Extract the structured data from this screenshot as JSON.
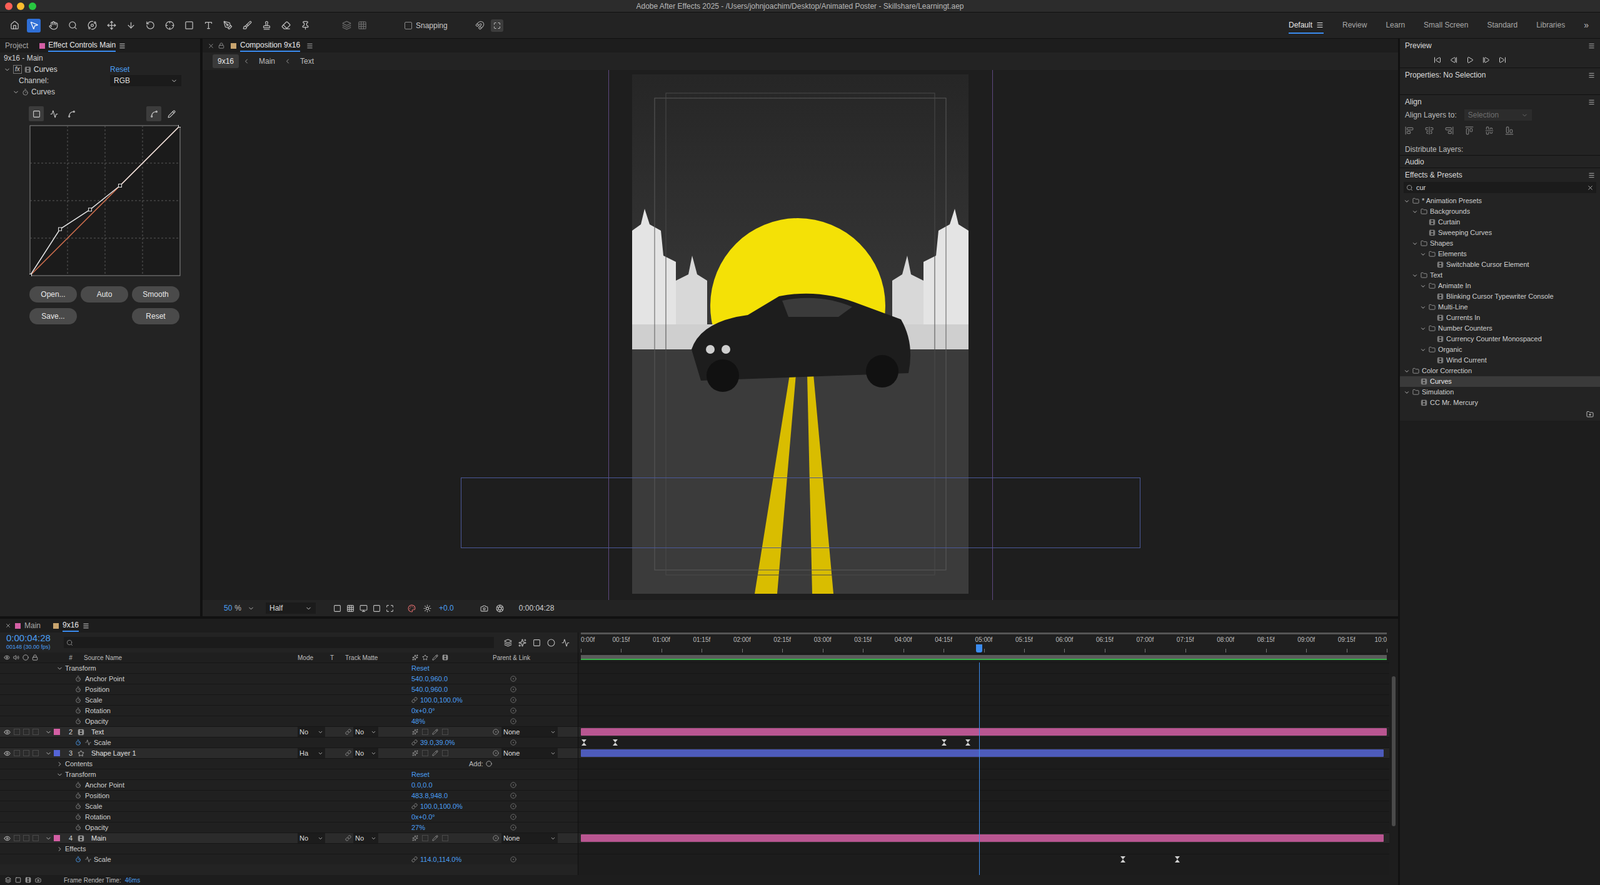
{
  "window": {
    "title": "Adobe After Effects 2025 - /Users/johnjoachim/Desktop/Animated Poster - Skillshare/Learningt.aep"
  },
  "toolbar": {
    "tools": [
      {
        "selected": false
      },
      {
        "selected": true
      },
      {
        "selected": false
      },
      {
        "selected": false
      },
      {
        "selected": false
      },
      {
        "selected": false
      },
      {
        "selected": false
      },
      {
        "selected": false
      },
      {
        "selected": false
      },
      {
        "selected": false
      },
      {
        "selected": false
      },
      {
        "selected": false
      },
      {
        "selected": false
      },
      {
        "selected": false
      },
      {
        "selected": false
      },
      {
        "selected": false
      }
    ],
    "snapping": {
      "label": "Snapping",
      "checked": false
    },
    "workspaces": [
      {
        "label": "Default",
        "selected": true
      },
      {
        "label": "Review",
        "selected": false
      },
      {
        "label": "Learn",
        "selected": false
      },
      {
        "label": "Small Screen",
        "selected": false
      },
      {
        "label": "Standard",
        "selected": false
      },
      {
        "label": "Libraries",
        "selected": false
      }
    ],
    "overflow": "»"
  },
  "effect_controls": {
    "tabs": [
      {
        "label": "Project",
        "selected": false,
        "color": ""
      },
      {
        "label": "Effect Controls Main",
        "selected": true,
        "color": "#d35fa4"
      }
    ],
    "layer": "9x16 - Main",
    "effect": {
      "badge": "fx",
      "name": "Curves",
      "reset": "Reset",
      "expanded": true
    },
    "channel": {
      "label": "Channel:",
      "value": "RGB"
    },
    "curves": {
      "label": "Curves",
      "expanded": true,
      "graph_modes": [
        {
          "selected": true
        },
        {
          "selected": false
        },
        {
          "selected": false
        }
      ],
      "draw_modes": [
        {
          "selected": true
        },
        {
          "selected": false
        }
      ],
      "points": [
        [
          0,
          0
        ],
        [
          0.2,
          0.31
        ],
        [
          0.4,
          0.44
        ],
        [
          0.6,
          0.6
        ],
        [
          1,
          1
        ]
      ]
    },
    "buttons_row1": [
      "Open...",
      "Auto",
      "Smooth"
    ],
    "buttons_row2": [
      "Save...",
      "Reset"
    ]
  },
  "composition": {
    "tab": "Composition 9x16",
    "tab_color": "#c8a46e",
    "breadcrumb": [
      {
        "label": "9x16",
        "selected": true
      },
      {
        "label": "Main",
        "selected": false
      },
      {
        "label": "Text",
        "selected": false
      }
    ],
    "zoom": "50",
    "zoom_unit": "%",
    "resolution": "Half",
    "exposure": "+0.0",
    "timecode": "0:00:04:28"
  },
  "preview": {
    "title": "Preview"
  },
  "properties": {
    "title": "Properties: No Selection"
  },
  "align": {
    "title": "Align",
    "align_to_label": "Align Layers to:",
    "align_to_value": "Selection",
    "align_to_disabled": true,
    "distribute_label": "Distribute Layers:"
  },
  "audio": {
    "title": "Audio"
  },
  "effects_presets": {
    "title": "Effects & Presets",
    "search": "cur",
    "items": [
      {
        "label": "* Animation Presets",
        "kind": "folder",
        "expanded": true,
        "selected": false,
        "children": [
          {
            "label": "Backgrounds",
            "kind": "folder",
            "expanded": true,
            "selected": false,
            "children": [
              {
                "label": "Curtain",
                "kind": "preset",
                "selected": false
              },
              {
                "label": "Sweeping Curves",
                "kind": "preset",
                "selected": false
              }
            ]
          },
          {
            "label": "Shapes",
            "kind": "folder",
            "expanded": true,
            "selected": false,
            "children": [
              {
                "label": "Elements",
                "kind": "folder",
                "expanded": true,
                "selected": false,
                "children": [
                  {
                    "label": "Switchable Cursor Element",
                    "kind": "preset",
                    "selected": false
                  }
                ]
              }
            ]
          },
          {
            "label": "Text",
            "kind": "folder",
            "expanded": true,
            "selected": false,
            "children": [
              {
                "label": "Animate In",
                "kind": "folder",
                "expanded": true,
                "selected": false,
                "children": [
                  {
                    "label": "Blinking Cursor Typewriter Console",
                    "kind": "preset",
                    "selected": false
                  }
                ]
              },
              {
                "label": "Multi-Line",
                "kind": "folder",
                "expanded": true,
                "selected": false,
                "children": [
                  {
                    "label": "Currents In",
                    "kind": "preset",
                    "selected": false
                  }
                ]
              },
              {
                "label": "Number Counters",
                "kind": "folder",
                "expanded": true,
                "selected": false,
                "children": [
                  {
                    "label": "Currency Counter Monospaced",
                    "kind": "preset",
                    "selected": false
                  }
                ]
              },
              {
                "label": "Organic",
                "kind": "folder",
                "expanded": true,
                "selected": false,
                "children": [
                  {
                    "label": "Wind Current",
                    "kind": "preset",
                    "selected": false
                  }
                ]
              }
            ]
          }
        ]
      },
      {
        "label": "Color Correction",
        "kind": "folder",
        "expanded": true,
        "selected": false,
        "children": [
          {
            "label": "Curves",
            "kind": "effect",
            "selected": true
          }
        ]
      },
      {
        "label": "Simulation",
        "kind": "folder",
        "expanded": true,
        "selected": false,
        "children": [
          {
            "label": "CC Mr. Mercury",
            "kind": "effect",
            "selected": false
          }
        ]
      }
    ]
  },
  "timeline": {
    "tabs": [
      {
        "label": "Main",
        "color": "#d35fa4",
        "selected": false
      },
      {
        "label": "9x16",
        "color": "#c8a46e",
        "selected": true
      }
    ],
    "timecode": "0:00:04:28",
    "frame_info": "00148 (30.00 fps)",
    "columns": {
      "number": "#",
      "source_name": "Source Name",
      "mode": "Mode",
      "t": "T",
      "track_matte": "Track Matte",
      "parent": "Parent & Link"
    },
    "ruler": [
      "0:00f",
      "00:15f",
      "01:00f",
      "01:15f",
      "02:00f",
      "02:15f",
      "03:00f",
      "03:15f",
      "04:00f",
      "04:15f",
      "05:00f",
      "05:15f",
      "06:00f",
      "06:15f",
      "07:00f",
      "07:15f",
      "08:00f",
      "08:15f",
      "09:00f",
      "09:15f",
      "10:0"
    ],
    "playhead": 0.494,
    "rows": [
      {
        "kind": "group",
        "name": "Transform",
        "expanded": true,
        "reset": "Reset"
      },
      {
        "kind": "property",
        "name": "Anchor Point",
        "value": "540.0,960.0",
        "linked": false,
        "animated": false,
        "keyframes": []
      },
      {
        "kind": "property",
        "name": "Position",
        "value": "540.0,960.0",
        "linked": false,
        "animated": false,
        "keyframes": []
      },
      {
        "kind": "property",
        "name": "Scale",
        "value": "100.0,100.0%",
        "linked": true,
        "animated": false,
        "keyframes": []
      },
      {
        "kind": "property",
        "name": "Rotation",
        "value": "0x+0.0°",
        "linked": false,
        "animated": false,
        "keyframes": []
      },
      {
        "kind": "property",
        "name": "Opacity",
        "value": "48%",
        "linked": false,
        "animated": false,
        "keyframes": []
      },
      {
        "kind": "layer",
        "number": "2",
        "name": "Text",
        "layer_type": "precomp",
        "color": "#d35fa4",
        "mode": "No",
        "track_matte": "No",
        "parent": "None",
        "expanded": true,
        "visible": true,
        "bar": [
          0,
          1
        ]
      },
      {
        "kind": "property",
        "name": "Scale",
        "value": "39.0,39.0%",
        "linked": true,
        "animated": true,
        "keyframes": [
          0.004,
          0.043,
          0.451,
          0.48
        ]
      },
      {
        "kind": "layer",
        "number": "3",
        "name": "Shape Layer 1",
        "layer_type": "shape",
        "color": "#5565d6",
        "mode": "Ha",
        "track_matte": "No",
        "parent": "None",
        "expanded": true,
        "visible": true,
        "bar": [
          0,
          0.996
        ]
      },
      {
        "kind": "group",
        "name": "Contents",
        "expanded": false,
        "action": "Add:"
      },
      {
        "kind": "group",
        "name": "Transform",
        "expanded": true,
        "reset": "Reset"
      },
      {
        "kind": "property",
        "name": "Anchor Point",
        "value": "0.0,0.0",
        "linked": false,
        "animated": false,
        "keyframes": []
      },
      {
        "kind": "property",
        "name": "Position",
        "value": "483.8,948.0",
        "linked": false,
        "animated": false,
        "keyframes": []
      },
      {
        "kind": "property",
        "name": "Scale",
        "value": "100.0,100.0%",
        "linked": true,
        "animated": false,
        "keyframes": []
      },
      {
        "kind": "property",
        "name": "Rotation",
        "value": "0x+0.0°",
        "linked": false,
        "animated": false,
        "keyframes": []
      },
      {
        "kind": "property",
        "name": "Opacity",
        "value": "27%",
        "linked": false,
        "animated": false,
        "keyframes": []
      },
      {
        "kind": "layer",
        "number": "4",
        "name": "Main",
        "layer_type": "precomp",
        "color": "#d35fa4",
        "mode": "No",
        "track_matte": "No",
        "parent": "None",
        "expanded": true,
        "visible": true,
        "bar": [
          0,
          0.996
        ]
      },
      {
        "kind": "group",
        "name": "Effects",
        "expanded": false
      },
      {
        "kind": "property",
        "name": "Scale",
        "value": "114.0,114.0%",
        "linked": true,
        "animated": true,
        "keyframes": [
          0.673,
          0.74
        ]
      }
    ]
  },
  "status_bar": {
    "label": "Frame Render Time:",
    "value": "46ms"
  }
}
